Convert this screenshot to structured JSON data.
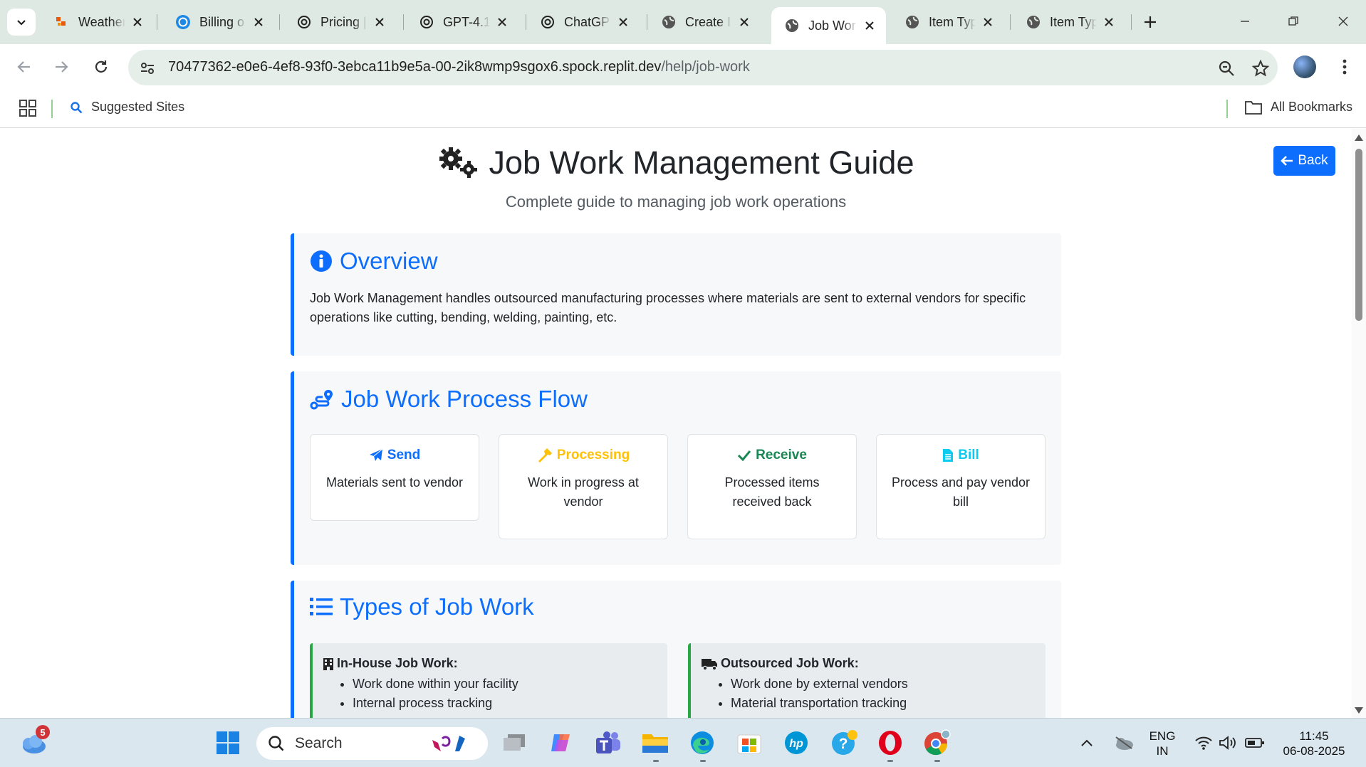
{
  "browser": {
    "tabs": [
      {
        "label": "Weather",
        "icon": "weather-icon"
      },
      {
        "label": "Billing o",
        "icon": "openai-icon"
      },
      {
        "label": "Pricing |",
        "icon": "openai-icon"
      },
      {
        "label": "GPT-4.1",
        "icon": "openai-icon"
      },
      {
        "label": "ChatGP",
        "icon": "openai-icon"
      },
      {
        "label": "Create I",
        "icon": "globe-icon"
      },
      {
        "label": "Job Wor",
        "icon": "globe-icon",
        "active": true
      },
      {
        "label": "Item Typ",
        "icon": "globe-icon"
      },
      {
        "label": "Item Typ",
        "icon": "globe-icon"
      }
    ],
    "url_host": "70477362-e0e6-4ef8-93f0-3ebca11b9e5a-00-2ik8wmp9sgox6.spock.replit.dev",
    "url_path": "/help/job-work",
    "bookmarks": {
      "suggested": "Suggested Sites",
      "all": "All Bookmarks"
    }
  },
  "page": {
    "title": "Job Work Management Guide",
    "subtitle": "Complete guide to managing job work operations",
    "back_label": "Back",
    "overview": {
      "heading": "Overview",
      "text": "Job Work Management handles outsourced manufacturing processes where materials are sent to external vendors for specific operations like cutting, bending, welding, painting, etc."
    },
    "process_flow": {
      "heading": "Job Work Process Flow",
      "steps": [
        {
          "title": "Send",
          "desc": "Materials sent to vendor",
          "color": "#0d6efd",
          "icon": "paper-plane-icon"
        },
        {
          "title": "Processing",
          "desc": "Work in progress at vendor",
          "color": "#ffc107",
          "icon": "hammer-icon"
        },
        {
          "title": "Receive",
          "desc": "Processed items received back",
          "color": "#198754",
          "icon": "check-icon"
        },
        {
          "title": "Bill",
          "desc": "Process and pay vendor bill",
          "color": "#0dcaf0",
          "icon": "invoice-icon"
        }
      ]
    },
    "types": {
      "heading": "Types of Job Work",
      "cards": [
        {
          "title": "In-House Job Work:",
          "icon": "building-icon",
          "items": [
            "Work done within your facility",
            "Internal process tracking"
          ]
        },
        {
          "title": "Outsourced Job Work:",
          "icon": "truck-icon",
          "items": [
            "Work done by external vendors",
            "Material transportation tracking"
          ]
        }
      ]
    }
  },
  "taskbar": {
    "search_placeholder": "Search",
    "weather_badge": "5",
    "lang_line1": "ENG",
    "lang_line2": "IN",
    "time": "11:45",
    "date": "06-08-2025"
  },
  "colors": {
    "primary": "#0d6efd",
    "success_border": "#28a745",
    "chrome_bg": "#dfe9e4"
  }
}
